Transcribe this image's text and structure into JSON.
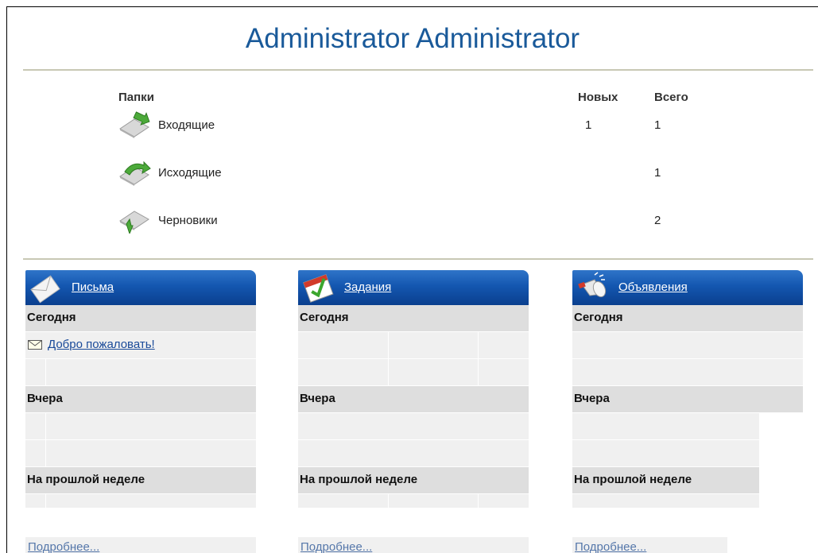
{
  "page": {
    "title": "Administrator Administrator"
  },
  "folders": {
    "headers": {
      "name": "Папки",
      "new": "Новых",
      "total": "Всего"
    },
    "items": [
      {
        "label": "Входящие",
        "new": "1",
        "total": "1",
        "icon": "inbox-icon"
      },
      {
        "label": "Исходящие",
        "new": "",
        "total": "1",
        "icon": "outbox-icon"
      },
      {
        "label": "Черновики",
        "new": "",
        "total": "2",
        "icon": "drafts-icon"
      }
    ]
  },
  "panels": [
    {
      "title": "Письма",
      "icon": "envelope-icon",
      "sections": {
        "today": "Сегодня",
        "yesterday": "Вчера",
        "last_week": "На прошлой неделе"
      },
      "items_today": [
        "Добро пожаловать!"
      ],
      "more": "Подробнее..."
    },
    {
      "title": "Задания",
      "icon": "calendar-check-icon",
      "sections": {
        "today": "Сегодня",
        "yesterday": "Вчера",
        "last_week": "На прошлой неделе"
      },
      "more": "Подробнее..."
    },
    {
      "title": "Объявления",
      "icon": "megaphone-icon",
      "sections": {
        "today": "Сегодня",
        "yesterday": "Вчера",
        "last_week": "На прошлой неделе"
      },
      "more": "Подробнее..."
    }
  ],
  "colors": {
    "title": "#1a5a9a",
    "panel_header": "#1457b0",
    "link": "#1a4a99",
    "section_bg": "#dedede",
    "row_bg": "#f0f0f0"
  }
}
